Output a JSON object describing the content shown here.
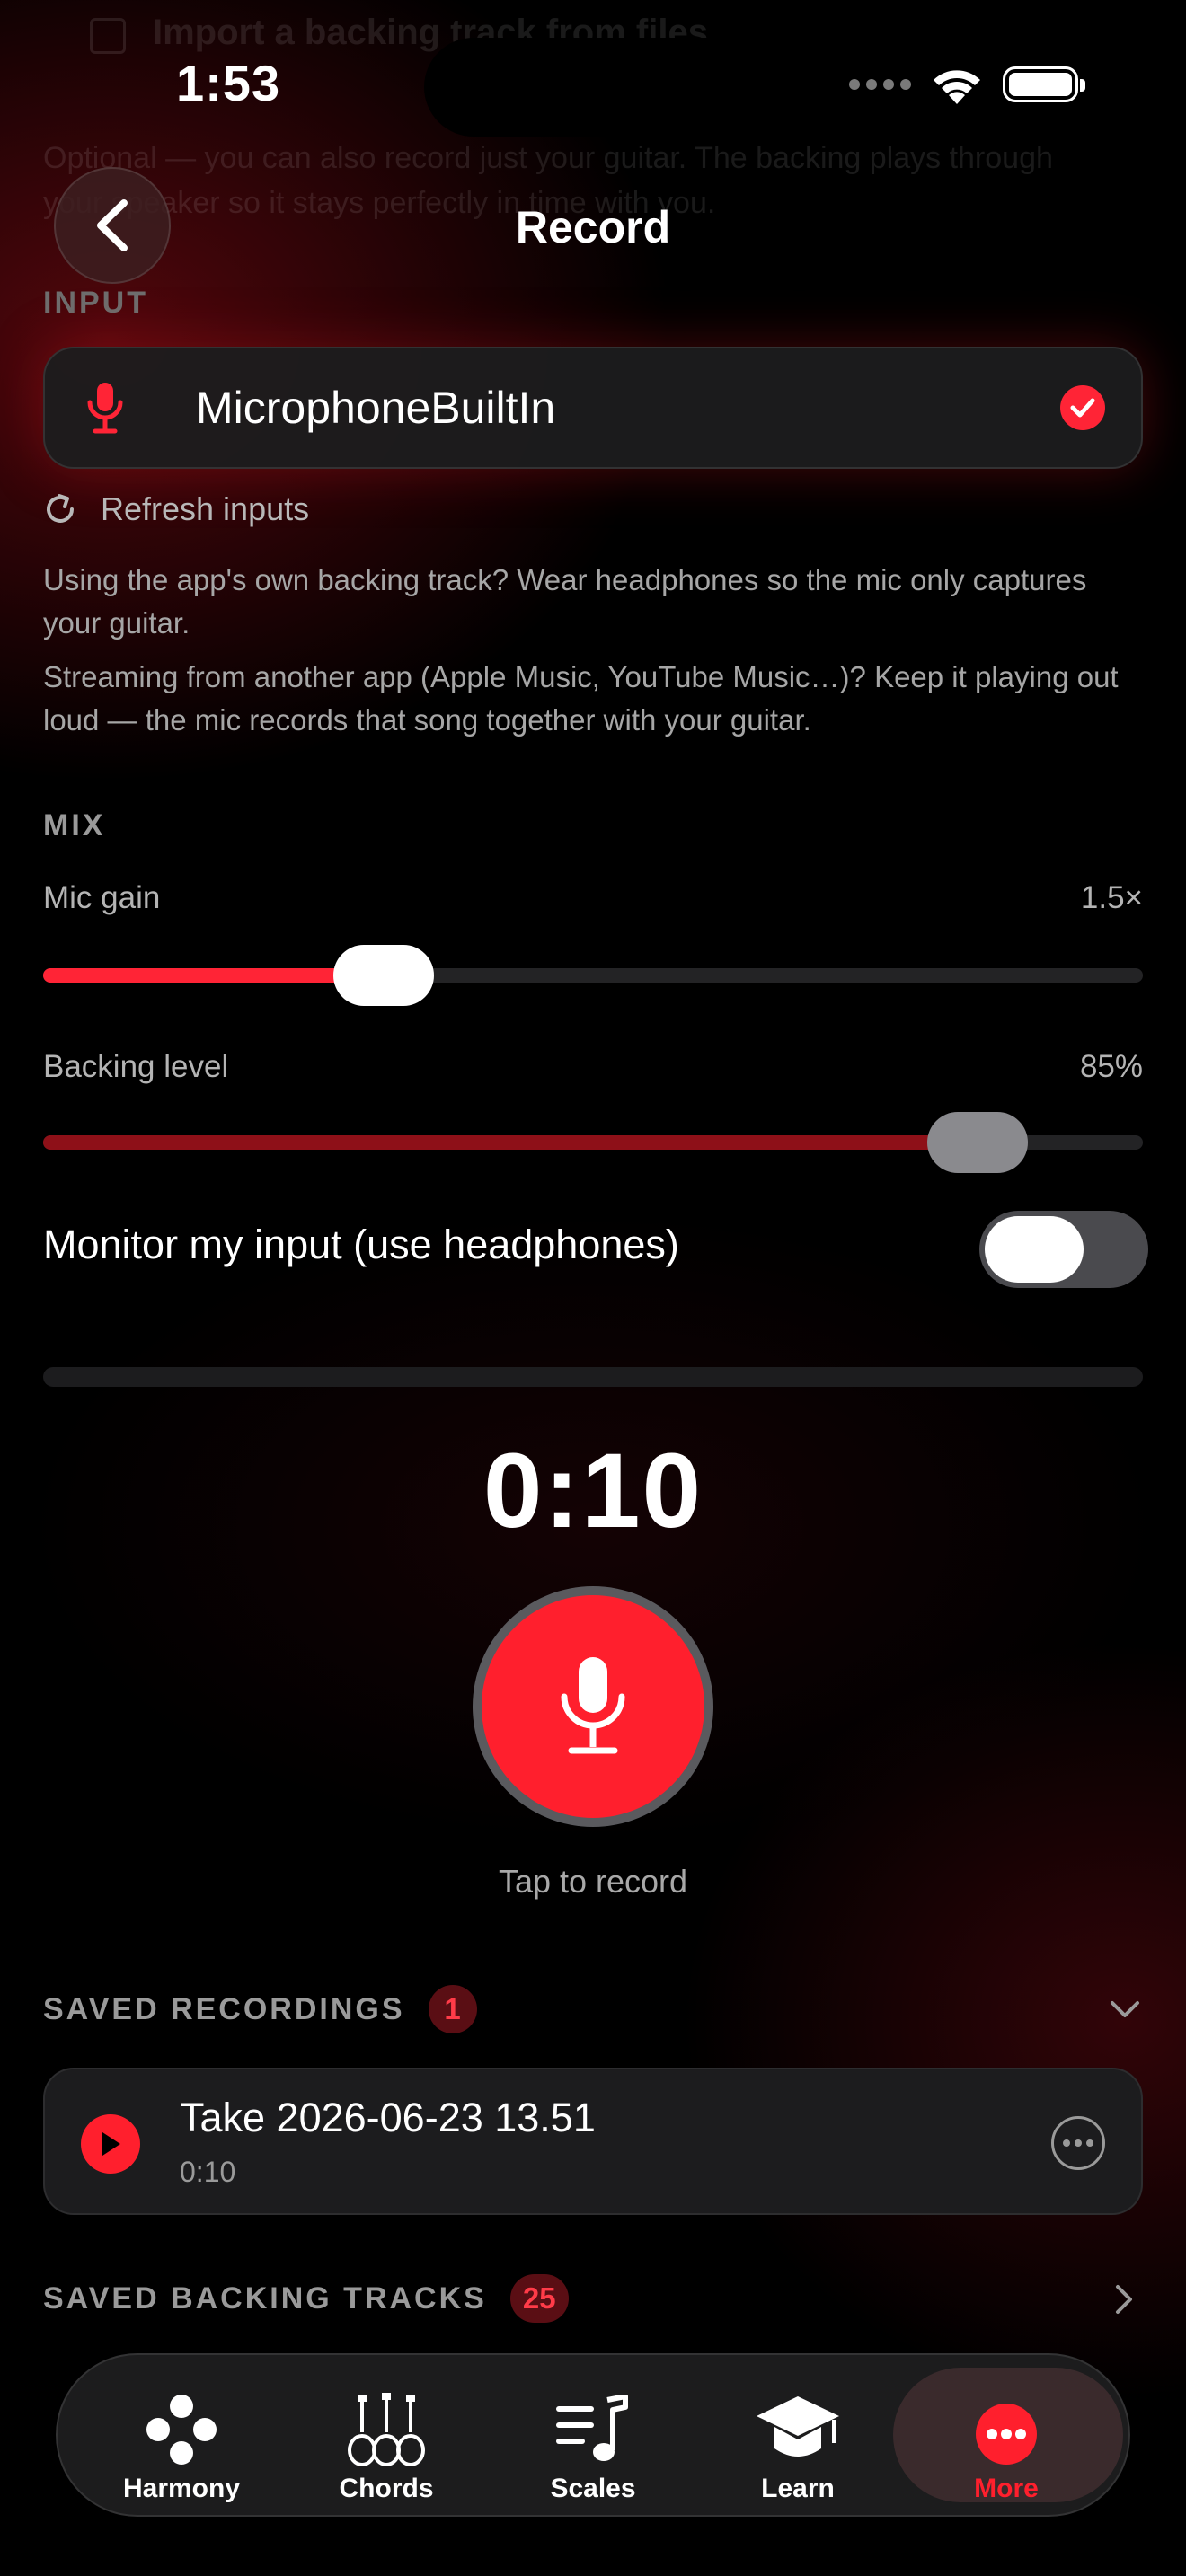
{
  "background_ghost": {
    "line1": "Import a backing track from files",
    "line2": "Optional — you can also record just your guitar. The backing plays through",
    "line3": "your speaker so it stays perfectly in time with you."
  },
  "status_bar": {
    "time": "1:53"
  },
  "nav": {
    "title": "Record",
    "back_icon": "chevron-left-icon"
  },
  "input_section": {
    "label": "INPUT",
    "device_name": "MicrophoneBuiltIn",
    "selected": true,
    "refresh_label": "Refresh inputs",
    "help_1": "Using the app's own backing track? Wear headphones so the mic only captures your guitar.",
    "help_2": "Streaming from another app (Apple Music, YouTube Music…)? Keep it playing out loud — the mic records that song together with your guitar."
  },
  "mix": {
    "label": "MIX",
    "mic_gain": {
      "label": "Mic gain",
      "value": "1.5×",
      "level": 0.31
    },
    "backing_level": {
      "label": "Backing level",
      "value": "85%",
      "level": 0.85
    },
    "monitor": {
      "label": "Monitor my input (use headphones)",
      "on": false
    }
  },
  "recorder": {
    "timer": "0:10",
    "hint": "Tap to record"
  },
  "saved_recordings": {
    "label": "SAVED RECORDINGS",
    "count": "1",
    "items": [
      {
        "title": "Take 2026-06-23 13.51",
        "duration": "0:10"
      }
    ]
  },
  "saved_backing_tracks": {
    "label": "SAVED BACKING TRACKS",
    "count": "25"
  },
  "tab_bar": {
    "tabs": [
      {
        "label": "Harmony",
        "icon": "harmony-icon"
      },
      {
        "label": "Chords",
        "icon": "guitars-icon"
      },
      {
        "label": "Scales",
        "icon": "music-list-icon"
      },
      {
        "label": "Learn",
        "icon": "graduation-cap-icon"
      },
      {
        "label": "More",
        "icon": "more-dots-icon",
        "active": true
      }
    ]
  },
  "colors": {
    "accent": "#ff1f2d",
    "background": "#000000",
    "card": "#1c1c1e",
    "secondary_text": "#a6a6a6"
  }
}
